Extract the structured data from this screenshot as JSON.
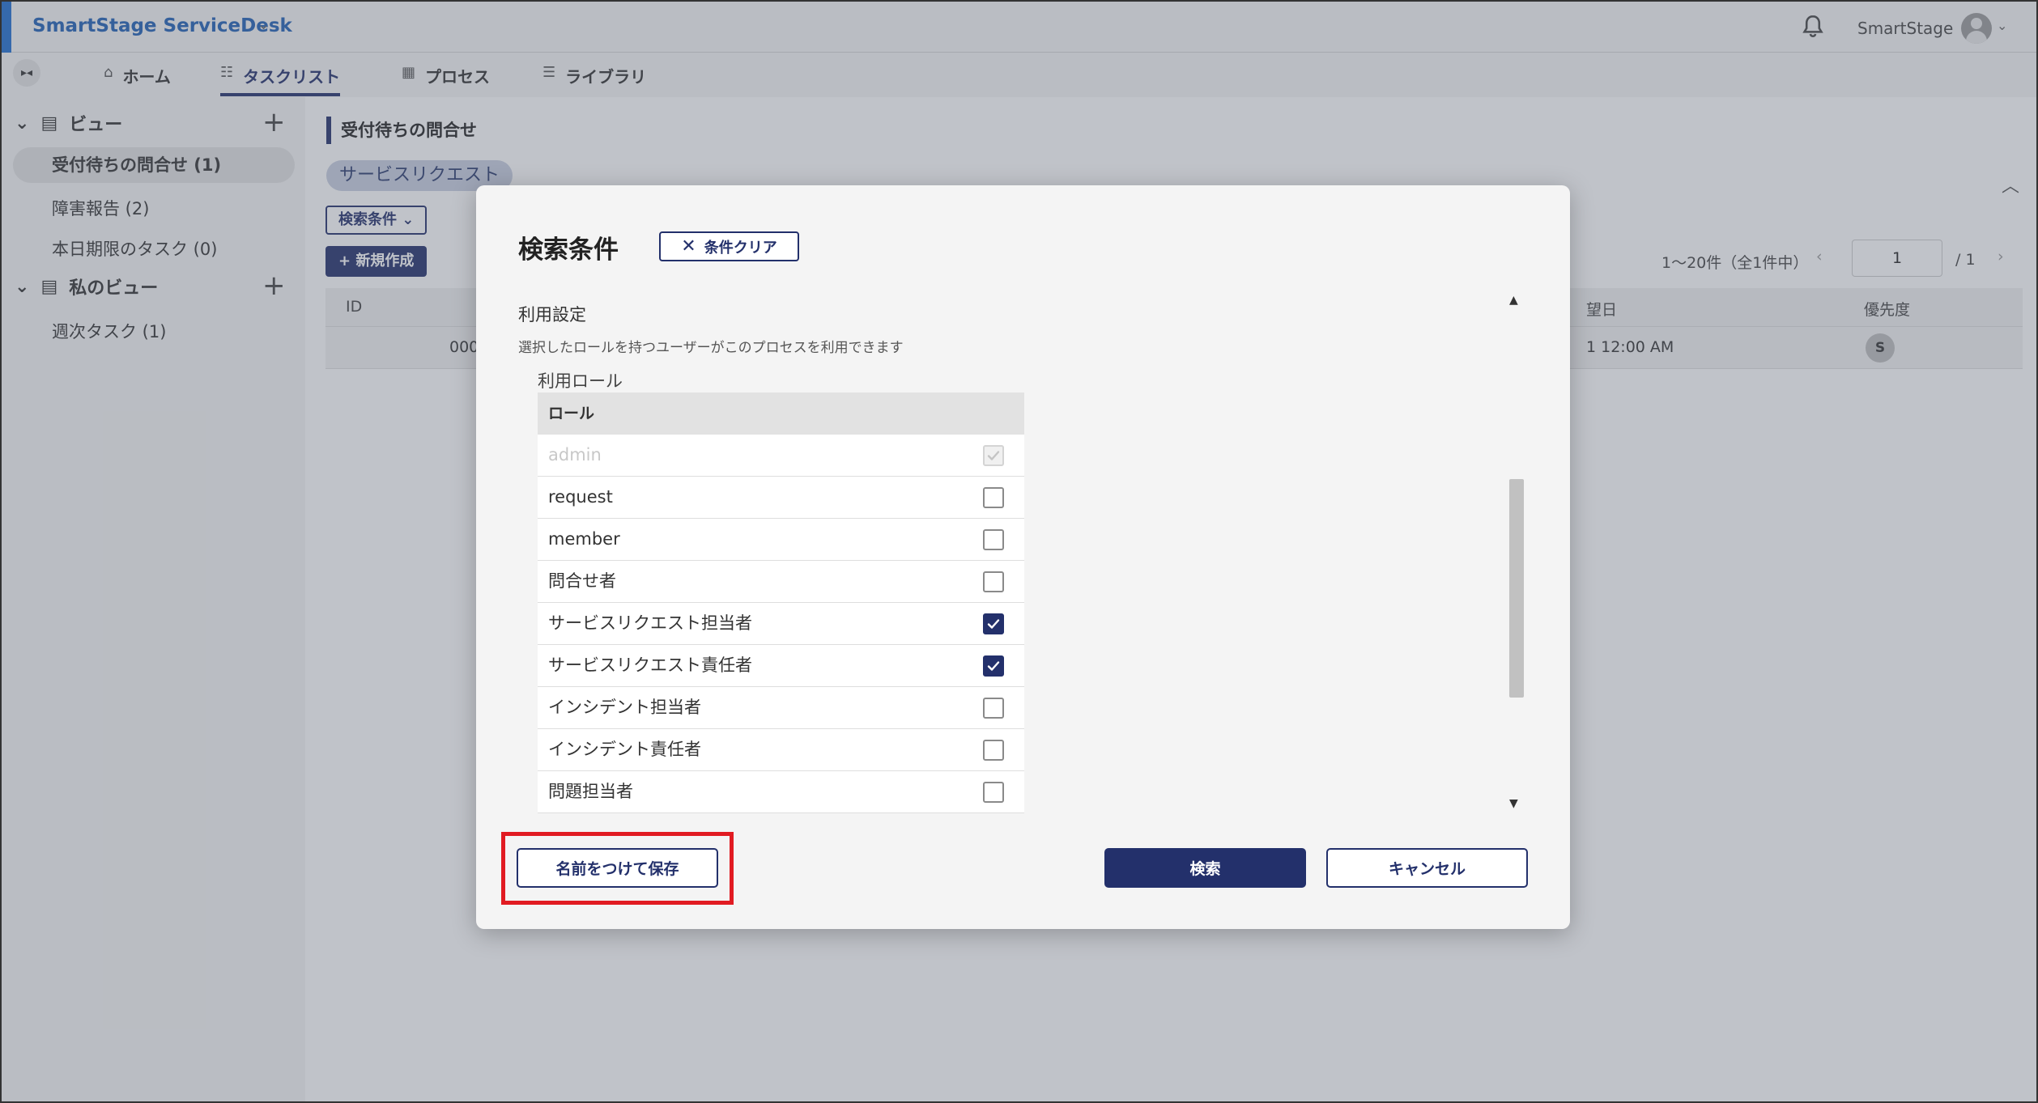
{
  "app": {
    "title": "SmartStage ServiceDesk",
    "user_name": "SmartStage"
  },
  "nav": {
    "items": [
      {
        "icon": "⌂",
        "label": "ホーム"
      },
      {
        "icon": "☷",
        "label": "タスクリスト"
      },
      {
        "icon": "▦",
        "label": "プロセス"
      },
      {
        "icon": "☰",
        "label": "ライブラリ"
      }
    ]
  },
  "sidebar": {
    "views_heading": "ビュー",
    "views": [
      "受付待ちの問合せ (1)",
      "障害報告 (2)",
      "本日期限のタスク (0)"
    ],
    "my_views_heading": "私のビュー",
    "my_views": [
      "週次タスク (1)"
    ]
  },
  "main": {
    "section_title": "受付待ちの問合せ",
    "filter_tag": "サービスリクエスト",
    "search_cond_button": "検索条件",
    "new_button": "新規作成",
    "pager_summary": "1〜20件（全1件中）",
    "page_value": "1",
    "page_total": "/ 1",
    "columns": [
      "ID",
      "望日",
      "優先度"
    ],
    "row": {
      "id_fragment": "000(",
      "date_fragment": "1 12:00 AM",
      "priority": "S"
    }
  },
  "dialog": {
    "title": "検索条件",
    "clear_button": "条件クリア",
    "section_title": "利用設定",
    "section_desc": "選択したロールを持つユーザーがこのプロセスを利用できます",
    "field_label": "利用ロール",
    "column_header": "ロール",
    "roles": [
      {
        "name": "admin",
        "checked": true,
        "disabled": true
      },
      {
        "name": "request",
        "checked": false,
        "disabled": false
      },
      {
        "name": "member",
        "checked": false,
        "disabled": false
      },
      {
        "name": "問合せ者",
        "checked": false,
        "disabled": false
      },
      {
        "name": "サービスリクエスト担当者",
        "checked": true,
        "disabled": false
      },
      {
        "name": "サービスリクエスト責任者",
        "checked": true,
        "disabled": false
      },
      {
        "name": "インシデント担当者",
        "checked": false,
        "disabled": false
      },
      {
        "name": "インシデント責任者",
        "checked": false,
        "disabled": false
      },
      {
        "name": "問題担当者",
        "checked": false,
        "disabled": false
      }
    ],
    "save_named_button": "名前をつけて保存",
    "search_button": "検索",
    "cancel_button": "キャンセル"
  },
  "colors": {
    "primary": "#23306b",
    "accent": "#1f6fd1",
    "highlight": "#e11b22"
  }
}
